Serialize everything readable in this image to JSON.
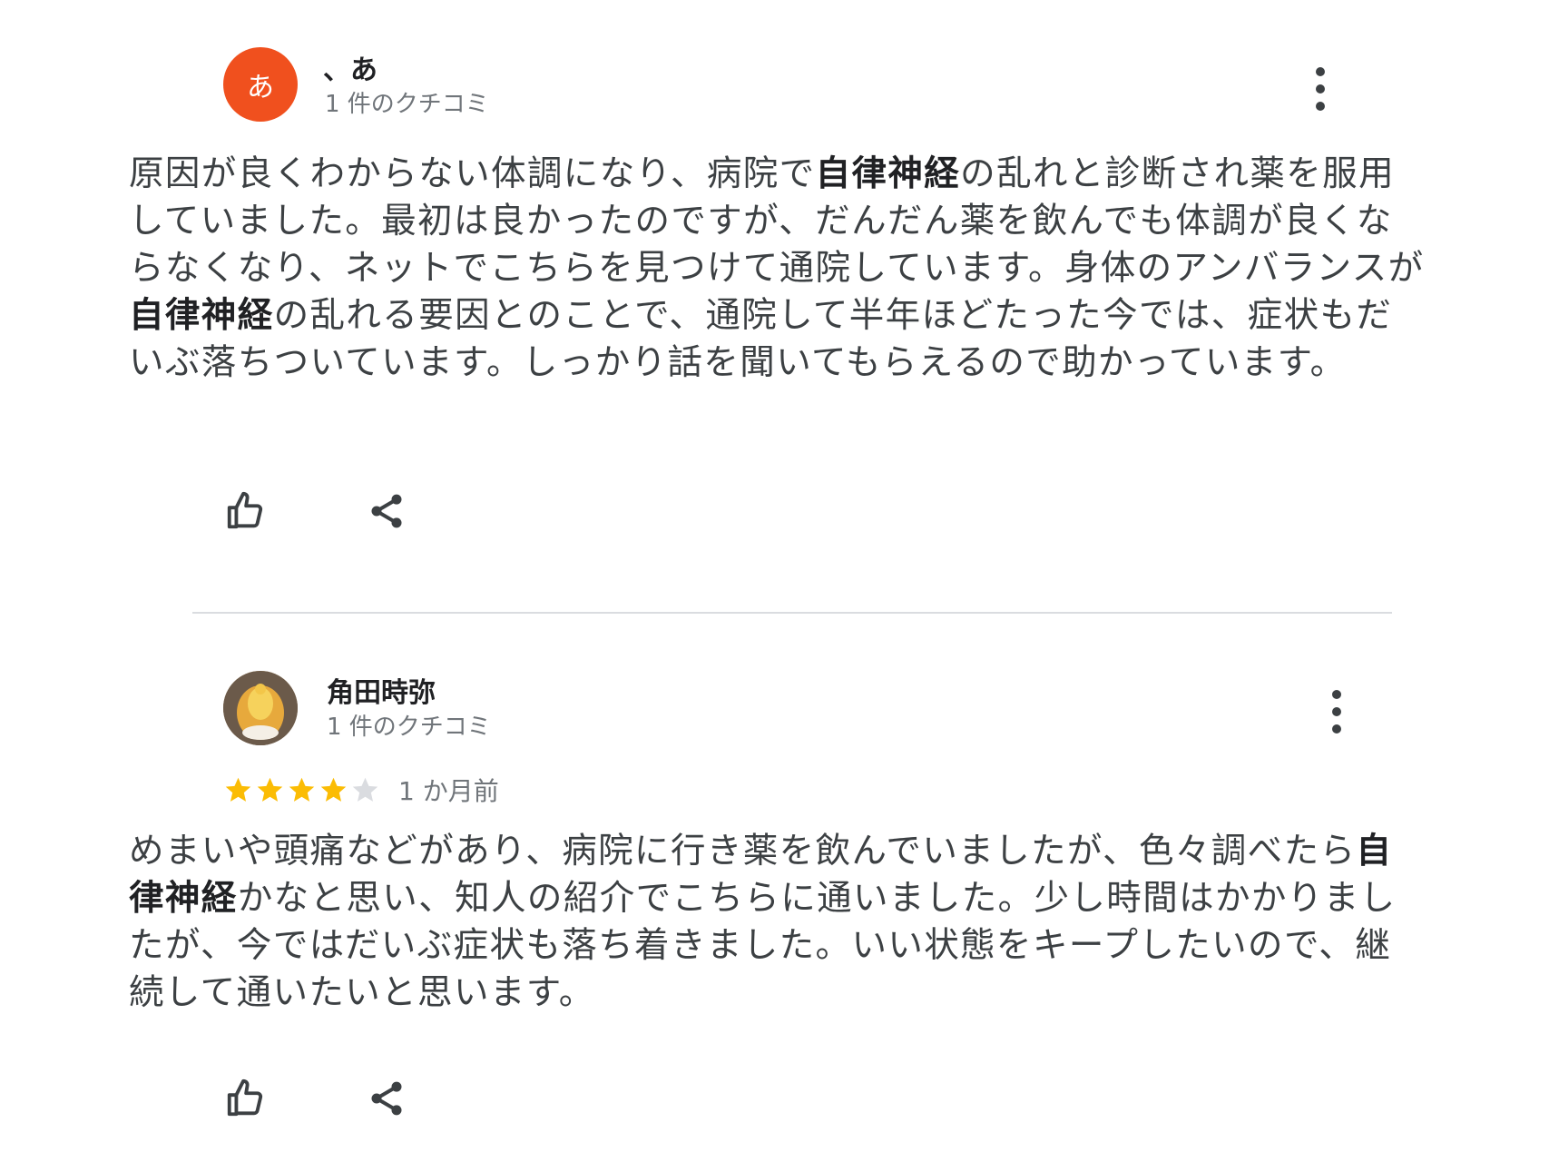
{
  "reviews": [
    {
      "author": "、あ",
      "avatar_letter": "あ",
      "avatar_color": "#f0501e",
      "review_count": "1 件のクチコミ",
      "text_segments": [
        {
          "text": "原因が良くわからない体調になり、病院で",
          "bold": false
        },
        {
          "text": "自律神経",
          "bold": true
        },
        {
          "text": "の乱れと診断され薬を服用していました。最初は良かったのですが、だんだん薬を飲んでも体調が良くならなくなり、ネットでこちらを見つけて通院しています。身体のアンバランスが",
          "bold": false
        },
        {
          "text": "自律神経",
          "bold": true
        },
        {
          "text": "の乱れる要因とのことで、通院して半年ほどたった今では、症状もだいぶ落ちついています。しっかり話を聞いてもらえるので助かっています。",
          "bold": false
        }
      ]
    },
    {
      "author": "角田時弥",
      "review_count": "1 件のクチコミ",
      "rating": 4,
      "rating_max": 5,
      "date": "1 か月前",
      "text_segments": [
        {
          "text": "めまいや頭痛などがあり、病院に行き薬を飲んでいましたが、色々調べたら",
          "bold": false
        },
        {
          "text": "自律神経",
          "bold": true
        },
        {
          "text": "かなと思い、知人の紹介でこちらに通いました。少し時間はかかりましたが、今ではだいぶ症状も落ち着きました。いい状態をキープしたいので、継続して通いたいと思います。",
          "bold": false
        }
      ]
    }
  ],
  "colors": {
    "star_filled": "#fbbc04",
    "star_empty": "#dadce0",
    "icon": "#3c4043",
    "divider": "#dadce0"
  },
  "icons": {
    "like": "thumbs-up-icon",
    "share": "share-icon",
    "menu": "more-vert-icon"
  }
}
